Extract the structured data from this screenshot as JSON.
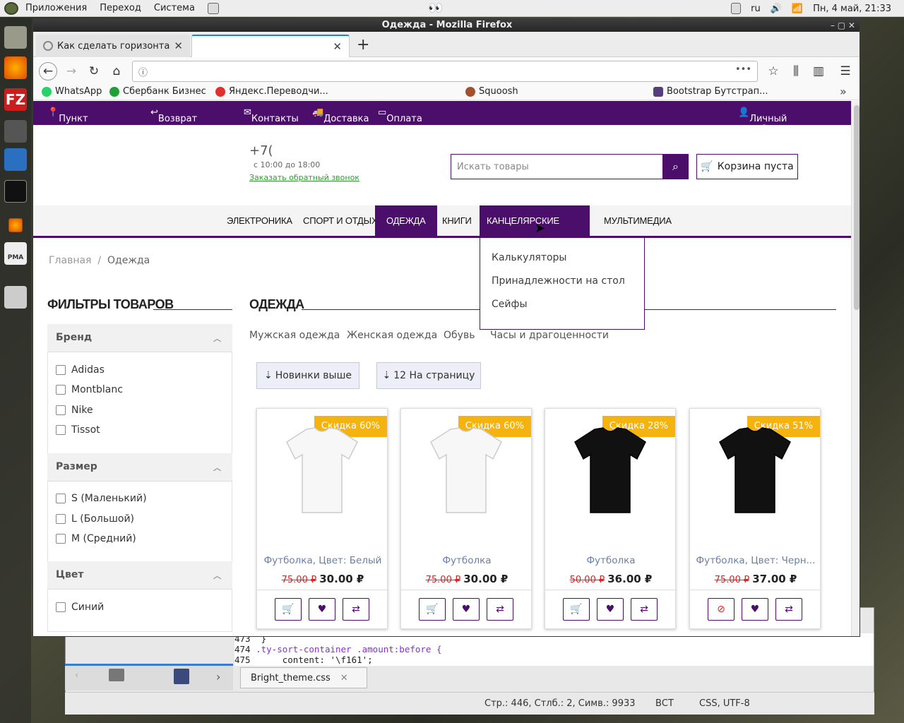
{
  "panel": {
    "apps": "Приложения",
    "places": "Переход",
    "system": "Система",
    "lang": "ru",
    "datetime": "Пн,  4 май, 21:33"
  },
  "window": {
    "title": "Одежда                            - Mozilla Firefox"
  },
  "tabs": [
    {
      "title": "Как сделать горизонта"
    },
    {
      "title": ""
    }
  ],
  "bookmarks": [
    "WhatsApp",
    "Сбербанк Бизнес",
    "Яндекс.Переводчи...",
    "Squoosh",
    "Bootstrap Бутстрап..."
  ],
  "site": {
    "topbar": [
      "Пункт самовывоза",
      "Возврат товара",
      "Контакты",
      "Доставка",
      "Оплата"
    ],
    "account": "Личный кабинет",
    "phone": "+7(",
    "hours": "с 10:00 до 18:00",
    "callback": "Заказать обратный звонок",
    "search_placeholder": "Искать товары",
    "cart": "Корзина пуста",
    "menu": [
      "ЭЛЕКТРОНИКА",
      "СПОРТ И ОТДЫХ",
      "ОДЕЖДА",
      "КНИГИ",
      "КАНЦЕЛЯРСКИЕ ТОВАРЫ",
      "МУЛЬТИМЕДИА"
    ],
    "dropdown": [
      "Калькуляторы",
      "Принадлежности на стол",
      "Сейфы"
    ],
    "breadcrumb": {
      "home": "Главная",
      "sep": "/",
      "current": "Одежда"
    },
    "filters_title": "ФИЛЬТРЫ ТОВАРОВ",
    "filters": {
      "brand": {
        "title": "Бренд",
        "items": [
          "Adidas",
          "Montblanc",
          "Nike",
          "Tissot"
        ]
      },
      "size": {
        "title": "Размер",
        "items": [
          "S (Маленький)",
          "L (Большой)",
          "M (Средний)"
        ]
      },
      "color": {
        "title": "Цвет",
        "items": [
          "Синий"
        ]
      }
    },
    "section_title": "ОДЕЖДА",
    "subcats": [
      "Мужская одежда",
      "Женская одежда",
      "Обувь",
      "Часы и драгоценности"
    ],
    "sort": "Новинки выше",
    "per_page": "12 На страницу",
    "products": [
      {
        "badge": "Скидка 60%",
        "name": "Футболка, Цвет: Белый",
        "old": "75.00 ₽",
        "price": "30.00 ₽",
        "color": "white"
      },
      {
        "badge": "Скидка 60%",
        "name": "Футболка",
        "old": "75.00 ₽",
        "price": "30.00 ₽",
        "color": "white"
      },
      {
        "badge": "Скидка 28%",
        "name": "Футболка",
        "old": "50.00 ₽",
        "price": "36.00 ₽",
        "color": "black"
      },
      {
        "badge": "Скидка 51%",
        "name": "Футболка, Цвет: Черн...",
        "old": "75.00 ₽",
        "price": "37.00 ₽",
        "color": "black"
      }
    ]
  },
  "editor": {
    "lines": [
      {
        "num": "473",
        "code": "}"
      },
      {
        "num": "474",
        "code": ".ty-sort-container .amount:before {"
      },
      {
        "num": "475",
        "code": "    content: '\\f161';"
      }
    ],
    "file": "Bright_theme.css",
    "status_pos": "Стр.: 446, Стлб.: 2, Симв.: 9933",
    "status_mode": "ВСТ",
    "status_enc": "CSS, UTF-8"
  },
  "colors": {
    "brand": "#4b0f6b",
    "badge": "#f5b30f",
    "old_price": "#e02020"
  }
}
